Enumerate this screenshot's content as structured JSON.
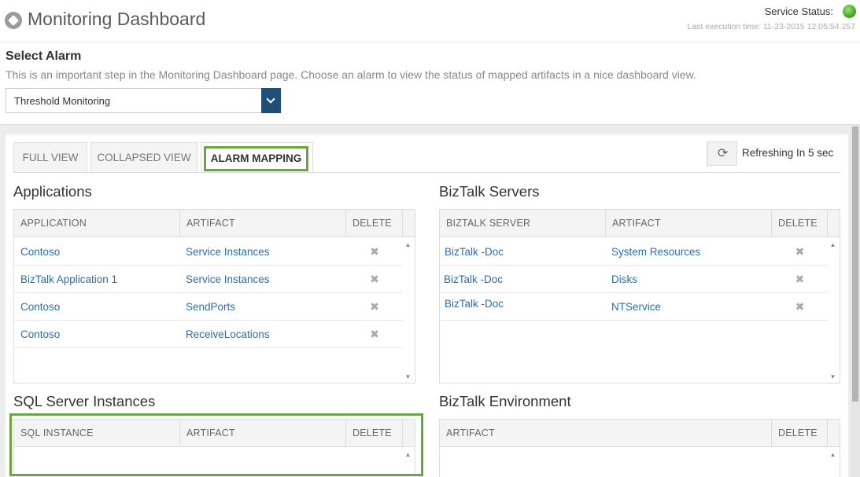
{
  "header": {
    "title": "Monitoring Dashboard",
    "service_status_label": "Service Status:",
    "status_color": "#4caf28",
    "last_execution": "Last execution time: 11-23-2015 12:05:54.257"
  },
  "select_alarm": {
    "title": "Select Alarm",
    "description": "This is an important step in the Monitoring Dashboard page. Choose an alarm to view the status of mapped artifacts in a nice dashboard view.",
    "selected": "Threshold Monitoring"
  },
  "tabs": [
    "FULL VIEW",
    "COLLAPSED VIEW",
    "ALARM MAPPING"
  ],
  "refresh_label": "Refreshing In 5 sec",
  "applications": {
    "title": "Applications",
    "headers": [
      "APPLICATION",
      "ARTIFACT",
      "DELETE"
    ],
    "rows": [
      [
        "Contoso",
        "Service Instances"
      ],
      [
        "BizTalk Application 1",
        "Service Instances"
      ],
      [
        "Contoso",
        "SendPorts"
      ],
      [
        "Contoso",
        "ReceiveLocations"
      ]
    ]
  },
  "biztalk_servers": {
    "title": "BizTalk Servers",
    "headers": [
      "BIZTALK SERVER",
      "ARTIFACT",
      "DELETE"
    ],
    "rows": [
      [
        "BizTalk -Doc",
        "System Resources"
      ],
      [
        "BizTalk -Doc",
        "Disks"
      ],
      [
        "BizTalk -Doc",
        "NTService"
      ]
    ]
  },
  "sql_instances": {
    "title": "SQL Server Instances",
    "headers": [
      "SQL INSTANCE",
      "ARTIFACT",
      "DELETE"
    ]
  },
  "biztalk_environment": {
    "title": "BizTalk Environment",
    "headers": [
      "ARTIFACT",
      "DELETE"
    ]
  },
  "delete_icon": "close-icon",
  "accent_color": "#6aa73a",
  "link_color": "#2f6da8"
}
